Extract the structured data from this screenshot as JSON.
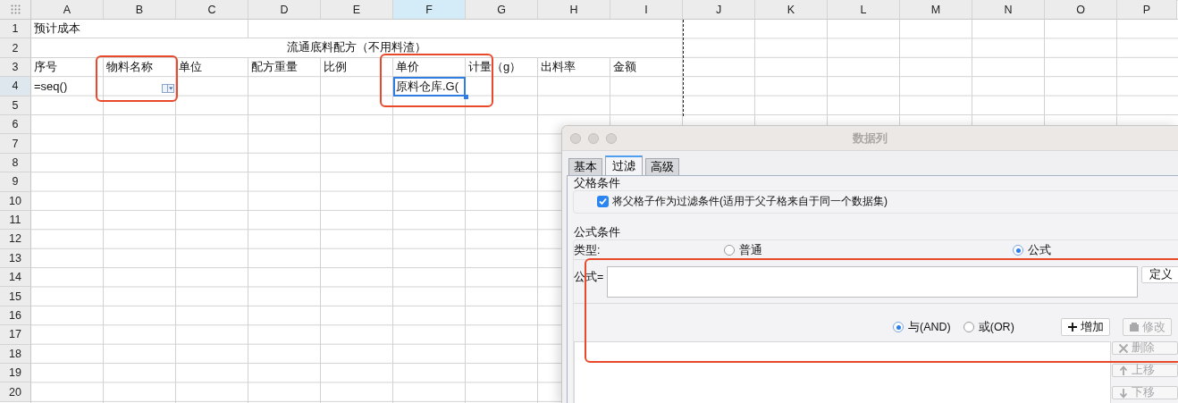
{
  "sheet": {
    "columns": [
      {
        "label": "A",
        "selected": false
      },
      {
        "label": "B",
        "selected": false
      },
      {
        "label": "C",
        "selected": false
      },
      {
        "label": "D",
        "selected": false
      },
      {
        "label": "E",
        "selected": false
      },
      {
        "label": "F",
        "selected": true
      },
      {
        "label": "G",
        "selected": false
      },
      {
        "label": "H",
        "selected": false
      },
      {
        "label": "I",
        "selected": false
      },
      {
        "label": "J",
        "selected": false
      },
      {
        "label": "K",
        "selected": false
      },
      {
        "label": "L",
        "selected": false
      },
      {
        "label": "M",
        "selected": false
      },
      {
        "label": "N",
        "selected": false
      },
      {
        "label": "O",
        "selected": false
      },
      {
        "label": "P",
        "selected": false
      }
    ],
    "rows": [
      {
        "number": "1",
        "selected": false,
        "cells": {
          "A": {
            "kind": "text",
            "text": "预计成本",
            "selected": false
          }
        }
      },
      {
        "number": "2",
        "selected": false,
        "cells": {
          "A": {
            "kind": "heading",
            "text": "流通底料配方（不用料渣）",
            "selected": false
          }
        }
      },
      {
        "number": "3",
        "selected": false,
        "cells": {
          "A": {
            "kind": "text",
            "text": "序号",
            "selected": false
          },
          "B": {
            "kind": "text",
            "text": "物料名称",
            "selected": false
          },
          "C": {
            "kind": "text",
            "text": "单位",
            "selected": false
          },
          "D": {
            "kind": "text",
            "text": "配方重量",
            "selected": false
          },
          "E": {
            "kind": "text",
            "text": "比例",
            "selected": false
          },
          "F": {
            "kind": "text",
            "text": "单价",
            "selected": false
          },
          "G": {
            "kind": "text",
            "text": "计量（g）",
            "selected": false
          },
          "H": {
            "kind": "text",
            "text": "出料率",
            "selected": false
          },
          "I": {
            "kind": "text",
            "text": "金额",
            "selected": false
          }
        }
      },
      {
        "number": "4",
        "selected": true,
        "cells": {
          "A": {
            "kind": "text",
            "text": "=seq()",
            "selected": false
          },
          "B": {
            "kind": "dropdown",
            "selected": false
          },
          "F": {
            "kind": "text",
            "text": "原料仓库.G(",
            "selected": true
          }
        }
      },
      {
        "number": "5",
        "selected": false,
        "cells": {}
      },
      {
        "number": "6",
        "selected": false,
        "cells": {}
      },
      {
        "number": "7",
        "selected": false,
        "cells": {}
      },
      {
        "number": "8",
        "selected": false,
        "cells": {}
      },
      {
        "number": "9",
        "selected": false,
        "cells": {}
      },
      {
        "number": "10",
        "selected": false,
        "cells": {}
      },
      {
        "number": "11",
        "selected": false,
        "cells": {}
      },
      {
        "number": "12",
        "selected": false,
        "cells": {}
      },
      {
        "number": "13",
        "selected": false,
        "cells": {}
      },
      {
        "number": "14",
        "selected": false,
        "cells": {}
      },
      {
        "number": "15",
        "selected": false,
        "cells": {}
      },
      {
        "number": "16",
        "selected": false,
        "cells": {}
      },
      {
        "number": "17",
        "selected": false,
        "cells": {}
      },
      {
        "number": "18",
        "selected": false,
        "cells": {}
      },
      {
        "number": "19",
        "selected": false,
        "cells": {}
      },
      {
        "number": "20",
        "selected": false,
        "cells": {}
      }
    ]
  },
  "dialog": {
    "title": "数据列",
    "tabs": [
      {
        "label": "基本",
        "selected": false
      },
      {
        "label": "过滤",
        "selected": true
      },
      {
        "label": "高级",
        "selected": false
      }
    ],
    "parent_section": {
      "title": "父格条件",
      "checkbox": {
        "label": "将父格子作为过滤条件(适用于父子格来自于同一个数据集)",
        "checked": true
      }
    },
    "formula_section": {
      "title": "公式条件",
      "type_label": "类型:",
      "type_options": [
        {
          "label": "普通",
          "selected": false
        },
        {
          "label": "公式",
          "selected": true
        }
      ],
      "formula_label": "公式=",
      "define_button": "定义",
      "logic_options": [
        {
          "label": "与(AND)",
          "selected": true
        },
        {
          "label": "或(OR)",
          "selected": false
        }
      ],
      "buttons": [
        {
          "kind": "add",
          "label": "增加",
          "disabled": false
        },
        {
          "kind": "edit",
          "label": "修改",
          "disabled": true
        },
        {
          "kind": "delete",
          "label": "删除",
          "disabled": true
        },
        {
          "kind": "up",
          "label": "上移",
          "disabled": true
        },
        {
          "kind": "down",
          "label": "下移",
          "disabled": true
        }
      ]
    }
  }
}
